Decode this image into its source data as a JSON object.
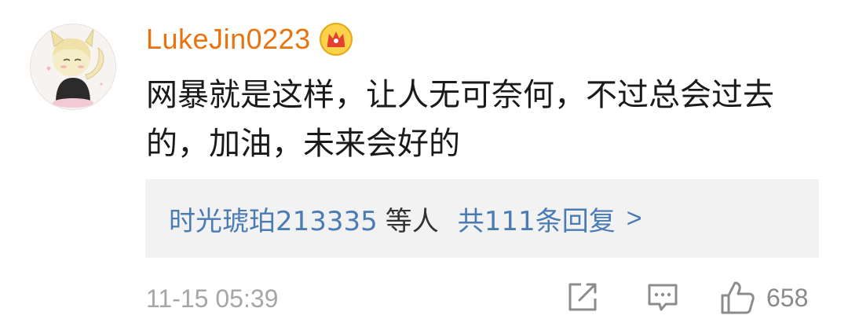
{
  "comment": {
    "avatar_icon": "user-avatar-fox-boy",
    "username": "LukeJin0223",
    "badge_icon": "vip-crown-icon",
    "text": "网暴就是这样，让人无可奈何，不过总会过去的，加油，未来会好的",
    "replies": {
      "users": "时光琥珀213335",
      "others": "等人",
      "total": "共111条回复",
      "chevron": ">"
    },
    "timestamp": "11-15 05:39",
    "actions": {
      "share_icon": "share-icon",
      "reply_icon": "comment-icon",
      "like_icon": "thumbs-up-icon",
      "like_count": "658"
    }
  },
  "colors": {
    "username": "#e8730f",
    "link": "#4a7bb3",
    "meta": "#a6a6a6",
    "reply_box_bg": "#f2f2f2"
  }
}
